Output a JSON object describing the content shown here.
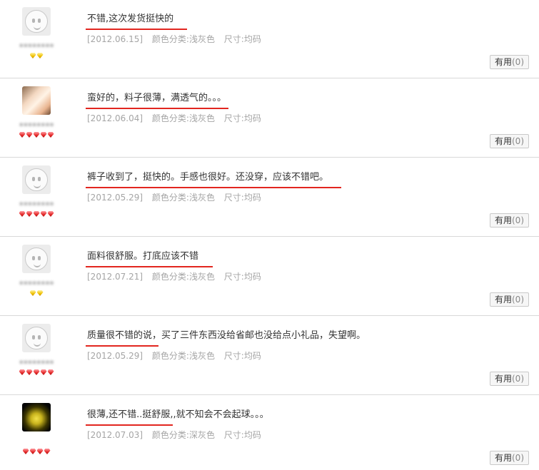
{
  "reviews": [
    {
      "content": "不错,这次发货挺快的",
      "date": "[2012.06.15]",
      "color": "颜色分类:浅灰色",
      "size": "尺寸:均码",
      "useful_label": "有用",
      "useful_count": "(0)"
    },
    {
      "content": "蛮好的，料子很薄，满透气的。。。",
      "date": "[2012.06.04]",
      "color": "颜色分类:浅灰色",
      "size": "尺寸:均码",
      "useful_label": "有用",
      "useful_count": "(0)"
    },
    {
      "content": "裤子收到了，挺快的。手感也很好。还没穿，应该不错吧。",
      "date": "[2012.05.29]",
      "color": "颜色分类:浅灰色",
      "size": "尺寸:均码",
      "useful_label": "有用",
      "useful_count": "(0)"
    },
    {
      "content": "面料很舒服。打底应该不错",
      "date": "[2012.07.21]",
      "color": "颜色分类:浅灰色",
      "size": "尺寸:均码",
      "useful_label": "有用",
      "useful_count": "(0)"
    },
    {
      "content": "质量很不错的说，买了三件东西没给省邮也没给点小礼品，失望啊。",
      "date": "[2012.05.29]",
      "color": "颜色分类:浅灰色",
      "size": "尺寸:均码",
      "useful_label": "有用",
      "useful_count": "(0)"
    },
    {
      "content": "很薄,还不错..挺舒服,,就不知会不会起球。。。",
      "date": "[2012.07.03]",
      "color": "颜色分类:深灰色",
      "size": "尺寸:均码",
      "useful_label": "有用",
      "useful_count": "(0)"
    }
  ],
  "colors": {
    "underline": "#e2261f",
    "gem_yellow": "#f0c000",
    "gem_red": "#e52a2a",
    "meta_text": "#a5a5a5"
  }
}
